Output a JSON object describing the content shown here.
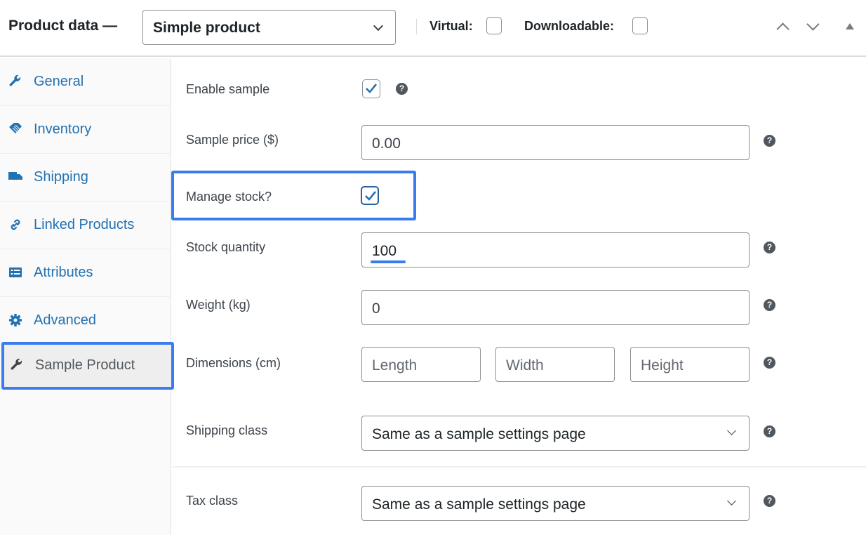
{
  "header": {
    "title": "Product data —",
    "product_type": {
      "selected": "Simple product"
    },
    "virtual": {
      "label": "Virtual:",
      "checked": false
    },
    "downloadable": {
      "label": "Downloadable:",
      "checked": false
    },
    "controls": [
      "move-up",
      "move-down",
      "toggle-panel"
    ]
  },
  "sidebar": {
    "active": "Sample Product",
    "tabs": [
      {
        "label": "General",
        "icon": "wrench-icon"
      },
      {
        "label": "Inventory",
        "icon": "tag-icon"
      },
      {
        "label": "Shipping",
        "icon": "truck-icon"
      },
      {
        "label": "Linked Products",
        "icon": "link-icon"
      },
      {
        "label": "Attributes",
        "icon": "list-card-icon"
      },
      {
        "label": "Advanced",
        "icon": "gear-icon"
      },
      {
        "label": "Sample Product",
        "icon": "wrench-icon"
      }
    ]
  },
  "form": {
    "enable_sample": {
      "label": "Enable sample",
      "checked": true
    },
    "sample_price": {
      "label": "Sample price ($)",
      "value": "0.00"
    },
    "manage_stock": {
      "label": "Manage stock?",
      "checked": true
    },
    "stock_quantity": {
      "label": "Stock quantity",
      "value": "100"
    },
    "weight": {
      "label": "Weight (kg)",
      "value": "0"
    },
    "dimensions": {
      "label": "Dimensions (cm)",
      "length_placeholder": "Length",
      "width_placeholder": "Width",
      "height_placeholder": "Height"
    },
    "shipping_class": {
      "label": "Shipping class",
      "selected": "Same as a sample settings page"
    },
    "tax_class": {
      "label": "Tax class",
      "selected": "Same as a sample settings page"
    },
    "help_glyph": "?"
  },
  "colors": {
    "accent": "#2271b1",
    "highlight": "#3a7cf0",
    "help": "#50575e"
  }
}
